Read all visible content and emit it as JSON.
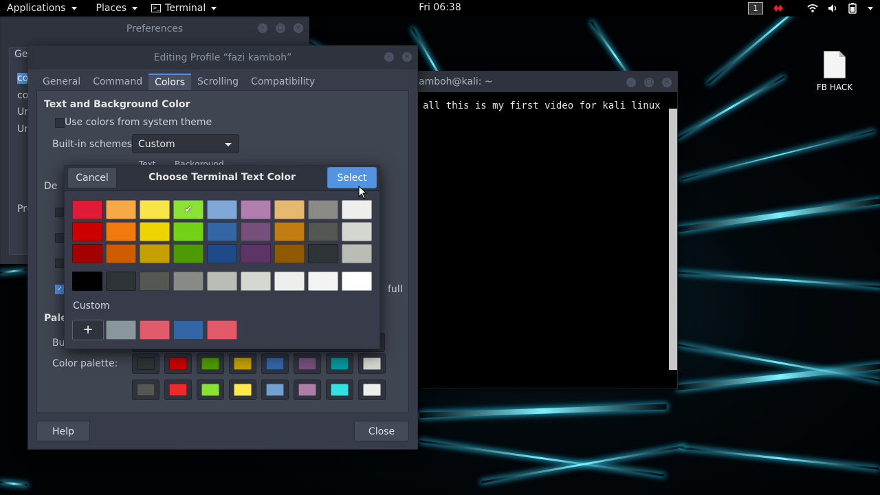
{
  "top_panel": {
    "applications_label": "Applications",
    "places_label": "Places",
    "terminal_label": "Terminal",
    "clock": "Fri 06:38",
    "workspace_number": "1"
  },
  "desktop": {
    "file_icon_label": "FB HACK"
  },
  "terminal_window": {
    "title": "amboh@kali: ~",
    "text": "all this is my first video for kali linux"
  },
  "preferences_window": {
    "title": "Preferences",
    "tab_partial": "Ge",
    "list_items": [
      "co",
      "co",
      "Ur",
      "Ur"
    ],
    "label_partial": "Pro"
  },
  "profile_window": {
    "title": "Editing Profile “fazi kamboh”",
    "tabs": [
      "General",
      "Command",
      "Colors",
      "Scrolling",
      "Compatibility"
    ],
    "active_tab": "Colors",
    "text_bg_section": "Text and Background Color",
    "use_system_colors": "Use colors from system theme",
    "builtin_schemes_label": "Built-in schemes:",
    "builtin_schemes_value": "Custom",
    "text_col_label": "Text",
    "bg_col_label": "Background",
    "default_partial": "De",
    "full_partial": "full",
    "palette_section": "Palet",
    "builtin_partial": "Bui",
    "color_palette_label": "Color palette:",
    "palette_row1": [
      "#2e3436",
      "#cc0000",
      "#4e9a06",
      "#c4a000",
      "#3465a4",
      "#75507b",
      "#06989a",
      "#d3d7cf"
    ],
    "palette_row2": [
      "#555753",
      "#ef2929",
      "#8ae234",
      "#fce94f",
      "#729fcf",
      "#ad7fa8",
      "#34e2e2",
      "#eeeeec"
    ],
    "help_label": "Help",
    "close_label": "Close"
  },
  "color_chooser": {
    "title": "Choose Terminal Text Color",
    "cancel_label": "Cancel",
    "select_label": "Select",
    "custom_label": "Custom",
    "add_label": "+",
    "selected_color": "#8ae234",
    "grid_rows": [
      [
        "#e01b38",
        "#f6a947",
        "#f8e54a",
        "#8ae234",
        "#7fa8d8",
        "#b07fb0",
        "#e4b86f",
        "#8a8b87",
        "#eeeeec"
      ],
      [
        "#cc0000",
        "#ef7a0d",
        "#edd400",
        "#73d216",
        "#3465a4",
        "#75507b",
        "#c17d11",
        "#555753",
        "#d3d7cf"
      ],
      [
        "#a40000",
        "#ce5c00",
        "#c4a000",
        "#4e9a06",
        "#204a87",
        "#5c3566",
        "#8f5902",
        "#2e3436",
        "#babdb6"
      ]
    ],
    "gray_row": [
      "#000000",
      "#2e3436",
      "#555753",
      "#888a85",
      "#babdb6",
      "#d3d7cf",
      "#eeeeec",
      "#f3f3f3",
      "#ffffff"
    ],
    "custom_colors": [
      "#88979b",
      "#e05c6a",
      "#3465a4",
      "#e25a69"
    ]
  }
}
